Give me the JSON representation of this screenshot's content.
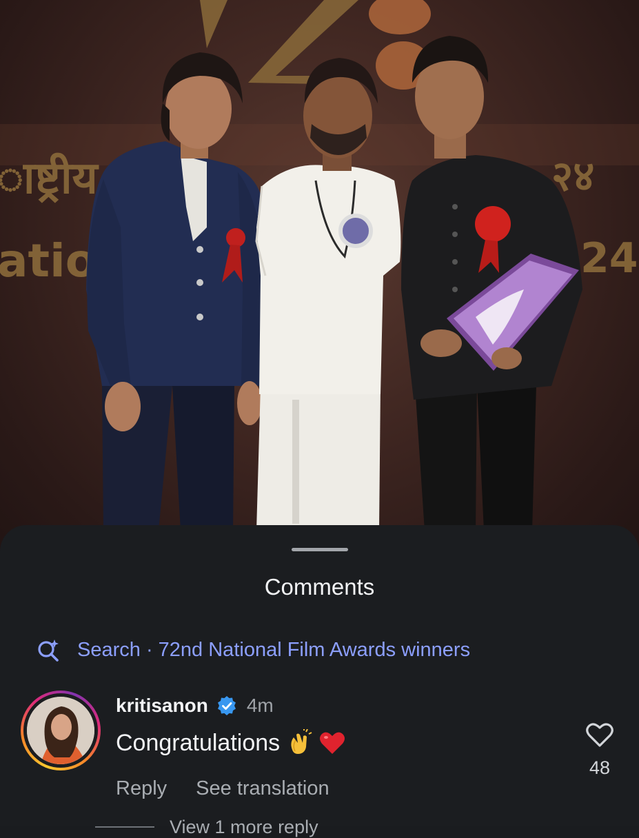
{
  "photo": {
    "backdrop_devanagari_left": "ाष्ट्रीय",
    "backdrop_devanagari_right": "२४",
    "backdrop_latin_left": "atio",
    "backdrop_latin_right": "24"
  },
  "sheet": {
    "title": "Comments",
    "search": {
      "prefix": "Search · ",
      "query": "72nd National Film Awards winners",
      "icon": "sparkle-search-icon"
    },
    "comments": [
      {
        "username": "kritisanon",
        "verified": true,
        "time": "4m",
        "text": "Congratulations",
        "emojis": [
          "clapping-hands-emoji",
          "red-heart-emoji"
        ],
        "actions": [
          "Reply",
          "See translation"
        ],
        "likes": "48"
      }
    ],
    "more_replies": "View 1 more reply"
  },
  "colors": {
    "sheet_bg": "#1b1d20",
    "accent_search": "#8c9fff",
    "verified_blue": "#3897f0",
    "text_primary": "#f2f3f5",
    "text_secondary": "#a9adb2"
  }
}
